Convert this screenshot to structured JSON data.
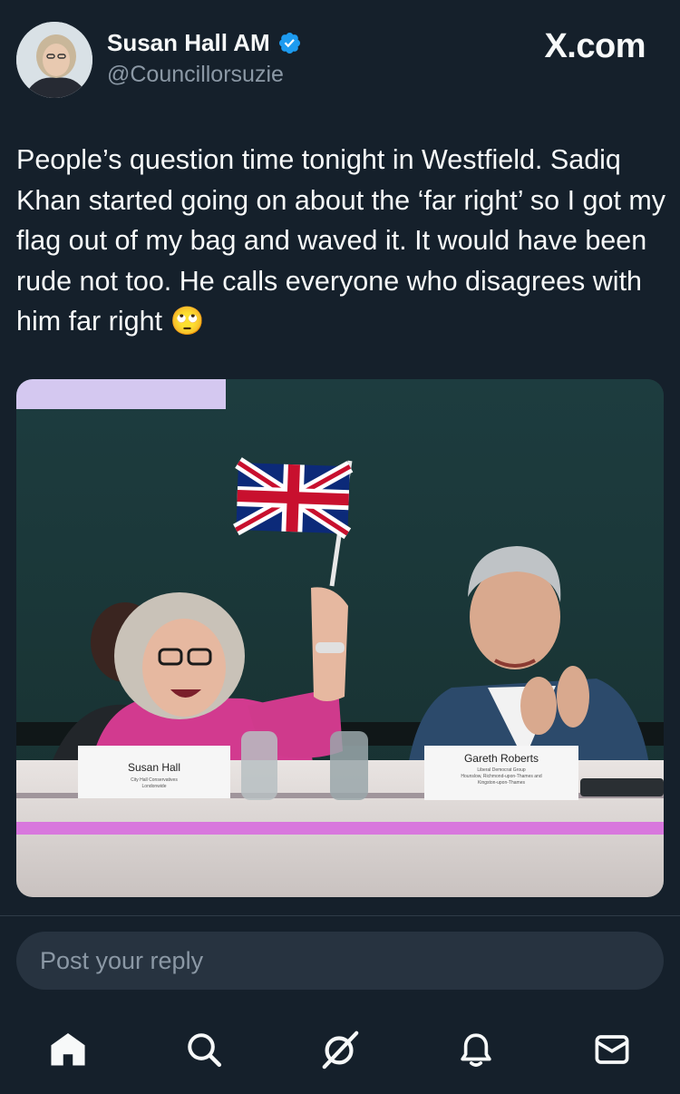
{
  "post": {
    "author": {
      "display_name": "Susan Hall AM",
      "handle": "@Councillorsuzie",
      "verified": true
    },
    "brand": "X.com",
    "text": "People’s question time tonight in Westfield. Sadiq Khan started going on about the ‘far right’ so I got my flag out of my bag and waved it. It would have been rude not too. He calls everyone who disagrees with him far right 🙄",
    "image": {
      "nameplate_left": {
        "name": "Susan Hall",
        "line1": "City Hall Conservatives",
        "line2": "Londonwide"
      },
      "nameplate_right": {
        "name": "Gareth Roberts",
        "line1": "Liberal Democrat Group",
        "line2": "Hounslow, Richmond-upon-Thames and",
        "line3": "Kingston-upon-Thames"
      }
    }
  },
  "reply": {
    "placeholder": "Post your reply"
  },
  "nav": {
    "items": [
      "home-icon",
      "search-icon",
      "grok-icon",
      "notifications-icon",
      "messages-icon"
    ]
  },
  "colors": {
    "background": "#15202b",
    "accent": "#1d9bf0",
    "muted": "#8b98a5"
  }
}
